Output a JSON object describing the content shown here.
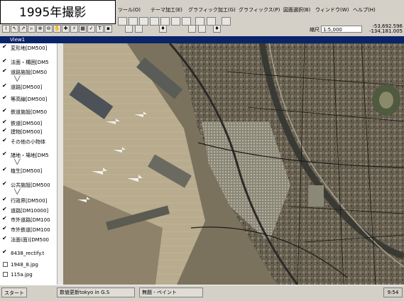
{
  "caption": "1995年撮影",
  "menu": [
    "ツール(O)",
    "テーマ加工(E)",
    "グラフィック加工(G)",
    "グラフィックス(P)",
    "図面選択(B)",
    "ウィンドウ(W)",
    "ヘルプ(H)"
  ],
  "toolbar": {
    "scale_label": "縮尺",
    "scale_value": "1:5,000",
    "coord_x": "-53,692.596",
    "coord_y": "-134,181.005"
  },
  "view_title": "View1",
  "legend": [
    {
      "label": "変形地[DM500]",
      "checked": true
    },
    {
      "label": "法面・構囲[DM5",
      "checked": true
    },
    {
      "label": "道路施設[DM50",
      "checked": true
    },
    {
      "label": "道路[DM500]",
      "checked": true
    },
    {
      "label": "等高線[DM500]",
      "checked": true
    },
    {
      "label": "鉄道施設[DM50",
      "checked": true
    },
    {
      "label": "鉄道[DM500]",
      "checked": true
    },
    {
      "label": "建物[DM500]",
      "checked": true
    },
    {
      "label": "その他の小物体",
      "checked": true
    },
    {
      "label": "諸地・場地[DM5",
      "checked": true
    },
    {
      "label": "植生[DM500]",
      "checked": true
    },
    {
      "label": "公共施設[DM500",
      "checked": true
    },
    {
      "label": "行政界[DM500]",
      "checked": true
    },
    {
      "label": "道路[DM10000]",
      "checked": true
    },
    {
      "label": "市外道路[DM100",
      "checked": true
    },
    {
      "label": "市外鉄道[DM100",
      "checked": true
    },
    {
      "label": "法面(面)[DM500",
      "checked": true
    },
    {
      "label": "8438_rectify.t",
      "checked": true
    },
    {
      "label": "1948_8.jpg",
      "checked": false
    },
    {
      "label": "115a.jpg",
      "checked": false
    }
  ],
  "taskbar": {
    "start": "スタート",
    "tasks": [
      "数値更新tokyo in G.S",
      "無題 - ペイント"
    ],
    "clock": "9:54"
  }
}
